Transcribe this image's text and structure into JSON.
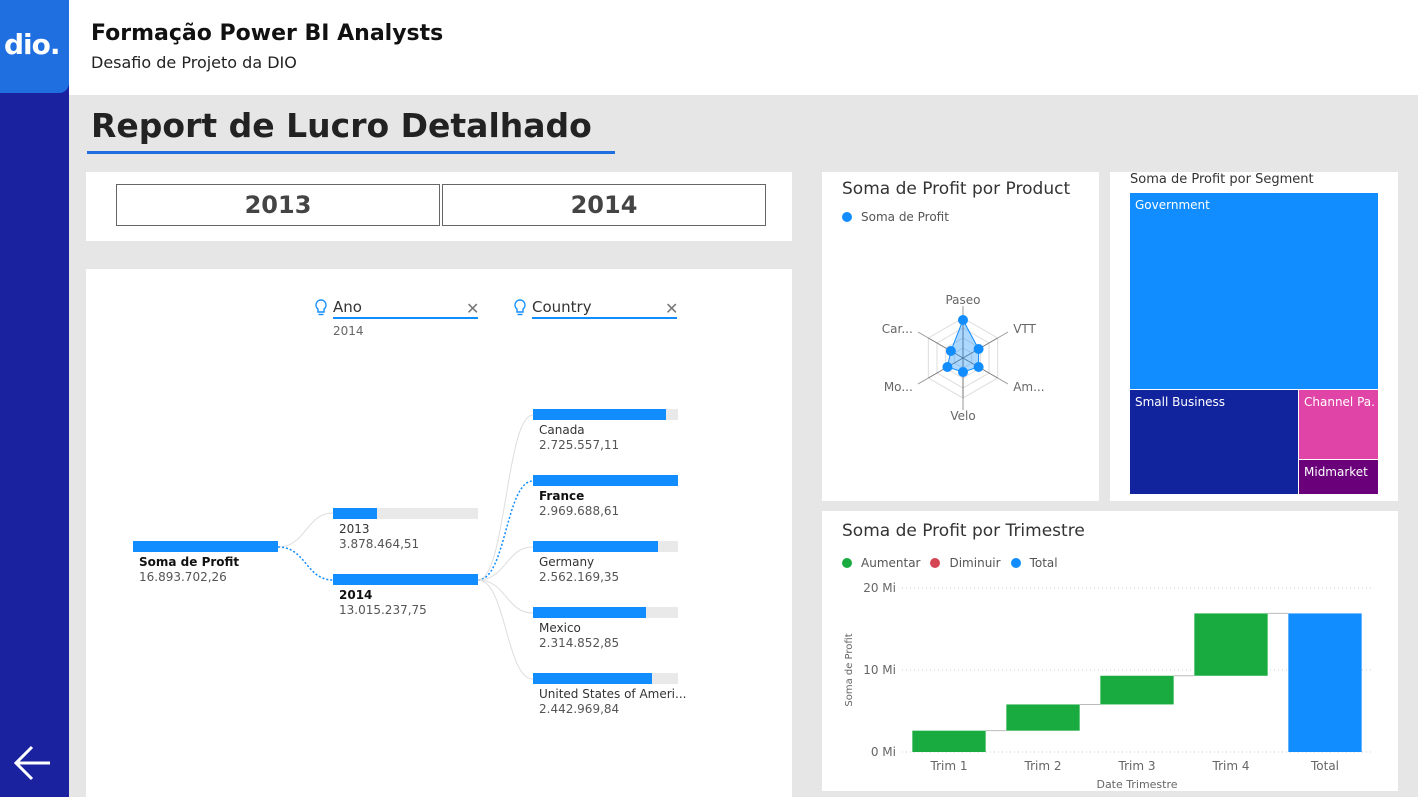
{
  "brand": {
    "logo_text": "dio."
  },
  "header": {
    "title": "Formação Power BI Analysts",
    "subtitle": "Desafio de Projeto da DIO"
  },
  "page": {
    "title": "Report de Lucro Detalhado"
  },
  "slicer": {
    "options": [
      "2013",
      "2014"
    ]
  },
  "decomposition_tree": {
    "levels": [
      {
        "label": "Ano",
        "filter": "2014"
      },
      {
        "label": "Country",
        "filter": ""
      }
    ],
    "root": {
      "label": "Soma de Profit",
      "value": "16.893.702,26"
    },
    "years": [
      {
        "label": "2013",
        "value": "3.878.464,51",
        "ratio": 0.3,
        "selected": false
      },
      {
        "label": "2014",
        "value": "13.015.237,75",
        "ratio": 1.0,
        "selected": true
      }
    ],
    "countries": [
      {
        "label": "Canada",
        "value": "2.725.557,11",
        "ratio": 0.918,
        "selected": false
      },
      {
        "label": "France",
        "value": "2.969.688,61",
        "ratio": 1.0,
        "selected": true
      },
      {
        "label": "Germany",
        "value": "2.562.169,35",
        "ratio": 0.863,
        "selected": false
      },
      {
        "label": "Mexico",
        "value": "2.314.852,85",
        "ratio": 0.78,
        "selected": false
      },
      {
        "label": "United States of Ameri...",
        "value": "2.442.969,84",
        "ratio": 0.823,
        "selected": false
      }
    ]
  },
  "radar_card": {
    "title": "Soma de Profit por Product",
    "legend": "Soma de Profit",
    "axes": [
      "Paseo",
      "VTT",
      "Am...",
      "Velo",
      "Mo...",
      "Car..."
    ]
  },
  "treemap_card": {
    "title": "Soma de Profit por Segment",
    "segments": [
      {
        "label": "Government",
        "color": "#118dff"
      },
      {
        "label": "Small Business",
        "color": "#12239e"
      },
      {
        "label": "Channel Pa...",
        "color": "#e044a7"
      },
      {
        "label": "Midmarket",
        "color": "#6b007b"
      }
    ]
  },
  "waterfall_card": {
    "title": "Soma de Profit por Trimestre",
    "legend": [
      {
        "label": "Aumentar",
        "color": "#1aab40"
      },
      {
        "label": "Diminuir",
        "color": "#d64554"
      },
      {
        "label": "Total",
        "color": "#118dff"
      }
    ],
    "ylabel": "Soma de Profit",
    "xlabel": "Date Trimestre",
    "y_ticks": [
      "0 Mi",
      "10 Mi",
      "20 Mi"
    ]
  },
  "chart_data": [
    {
      "type": "radar",
      "title": "Soma de Profit por Product",
      "categories": [
        "Paseo",
        "VTT",
        "Am...",
        "Velo",
        "Mo...",
        "Car..."
      ],
      "series": [
        {
          "name": "Soma de Profit",
          "values": [
            0.95,
            0.45,
            0.45,
            0.35,
            0.45,
            0.35
          ]
        }
      ],
      "range": [
        0,
        1
      ]
    },
    {
      "type": "treemap",
      "title": "Soma de Profit por Segment",
      "categories": [
        "Government",
        "Small Business",
        "Channel Pa...",
        "Midmarket"
      ],
      "values": [
        11.4,
        4.1,
        1.7,
        0.7
      ]
    },
    {
      "type": "bar",
      "subtype": "waterfall",
      "title": "Soma de Profit por Trimestre",
      "categories": [
        "Trim 1",
        "Trim 2",
        "Trim 3",
        "Trim 4",
        "Total"
      ],
      "values": [
        2.6,
        3.2,
        3.5,
        7.6,
        16.9
      ],
      "xlabel": "Date Trimestre",
      "ylabel": "Soma de Profit",
      "ylim": [
        0,
        20
      ]
    }
  ]
}
